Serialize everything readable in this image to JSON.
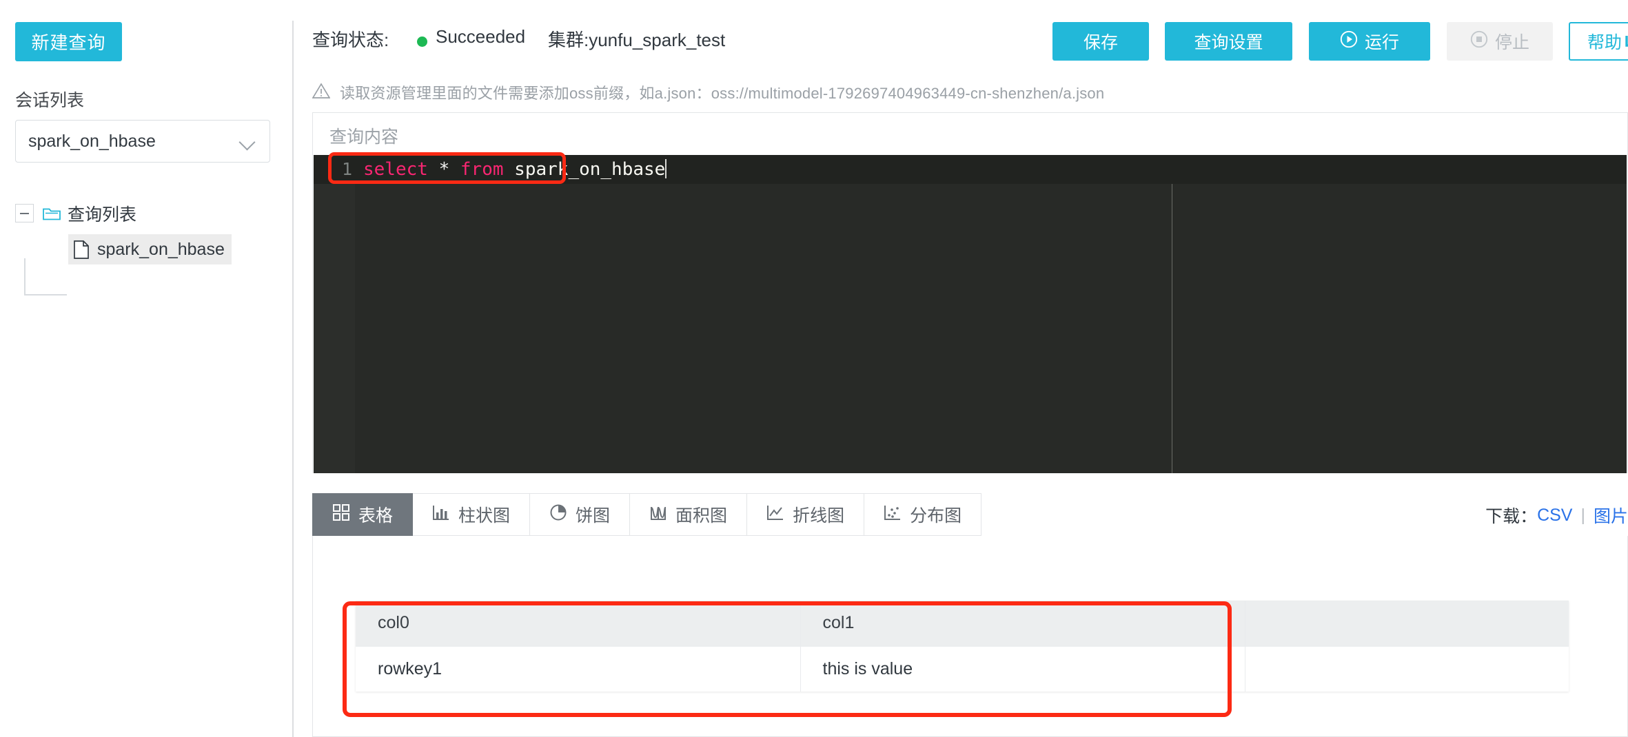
{
  "sidebar": {
    "new_query_button": "新建查询",
    "session_section_label": "会话列表",
    "session_selected": "spark_on_hbase",
    "tree": {
      "root_label": "查询列表",
      "children": [
        {
          "label": "spark_on_hbase",
          "selected": true
        }
      ]
    }
  },
  "header": {
    "status_label": "查询状态:",
    "status_value": "Succeeded",
    "status_color": "#1db954",
    "cluster": "集群:yunfu_spark_test",
    "buttons": {
      "save": "保存",
      "settings": "查询设置",
      "run": "运行",
      "stop": "停止",
      "help": "帮助"
    }
  },
  "notice": {
    "text": "读取资源管理里面的文件需要添加oss前缀，如a.json：oss://multimodel-1792697404963449-cn-shenzhen/a.json"
  },
  "editor": {
    "title": "查询内容",
    "line_number": "1",
    "code_tokens": {
      "kw_select": "select",
      "star": "*",
      "kw_from": "from",
      "table": "spark_on_hbase"
    },
    "code_full": "select * from spark_on_hbase"
  },
  "result_tabs": [
    {
      "label": "表格",
      "icon": "grid-icon",
      "active": true
    },
    {
      "label": "柱状图",
      "icon": "bar-chart-icon",
      "active": false
    },
    {
      "label": "饼图",
      "icon": "pie-chart-icon",
      "active": false
    },
    {
      "label": "面积图",
      "icon": "area-chart-icon",
      "active": false
    },
    {
      "label": "折线图",
      "icon": "line-chart-icon",
      "active": false
    },
    {
      "label": "分布图",
      "icon": "scatter-chart-icon",
      "active": false
    }
  ],
  "download": {
    "label": "下载：",
    "csv": "CSV",
    "separator": "|",
    "image": "图片"
  },
  "results_table": {
    "columns": [
      "col0",
      "col1",
      ""
    ],
    "rows": [
      [
        "rowkey1",
        "this is value",
        ""
      ]
    ]
  },
  "accents": {
    "primary": "#22b8d9",
    "highlight_red": "#fc2a14",
    "link_blue": "#2a72e8"
  }
}
